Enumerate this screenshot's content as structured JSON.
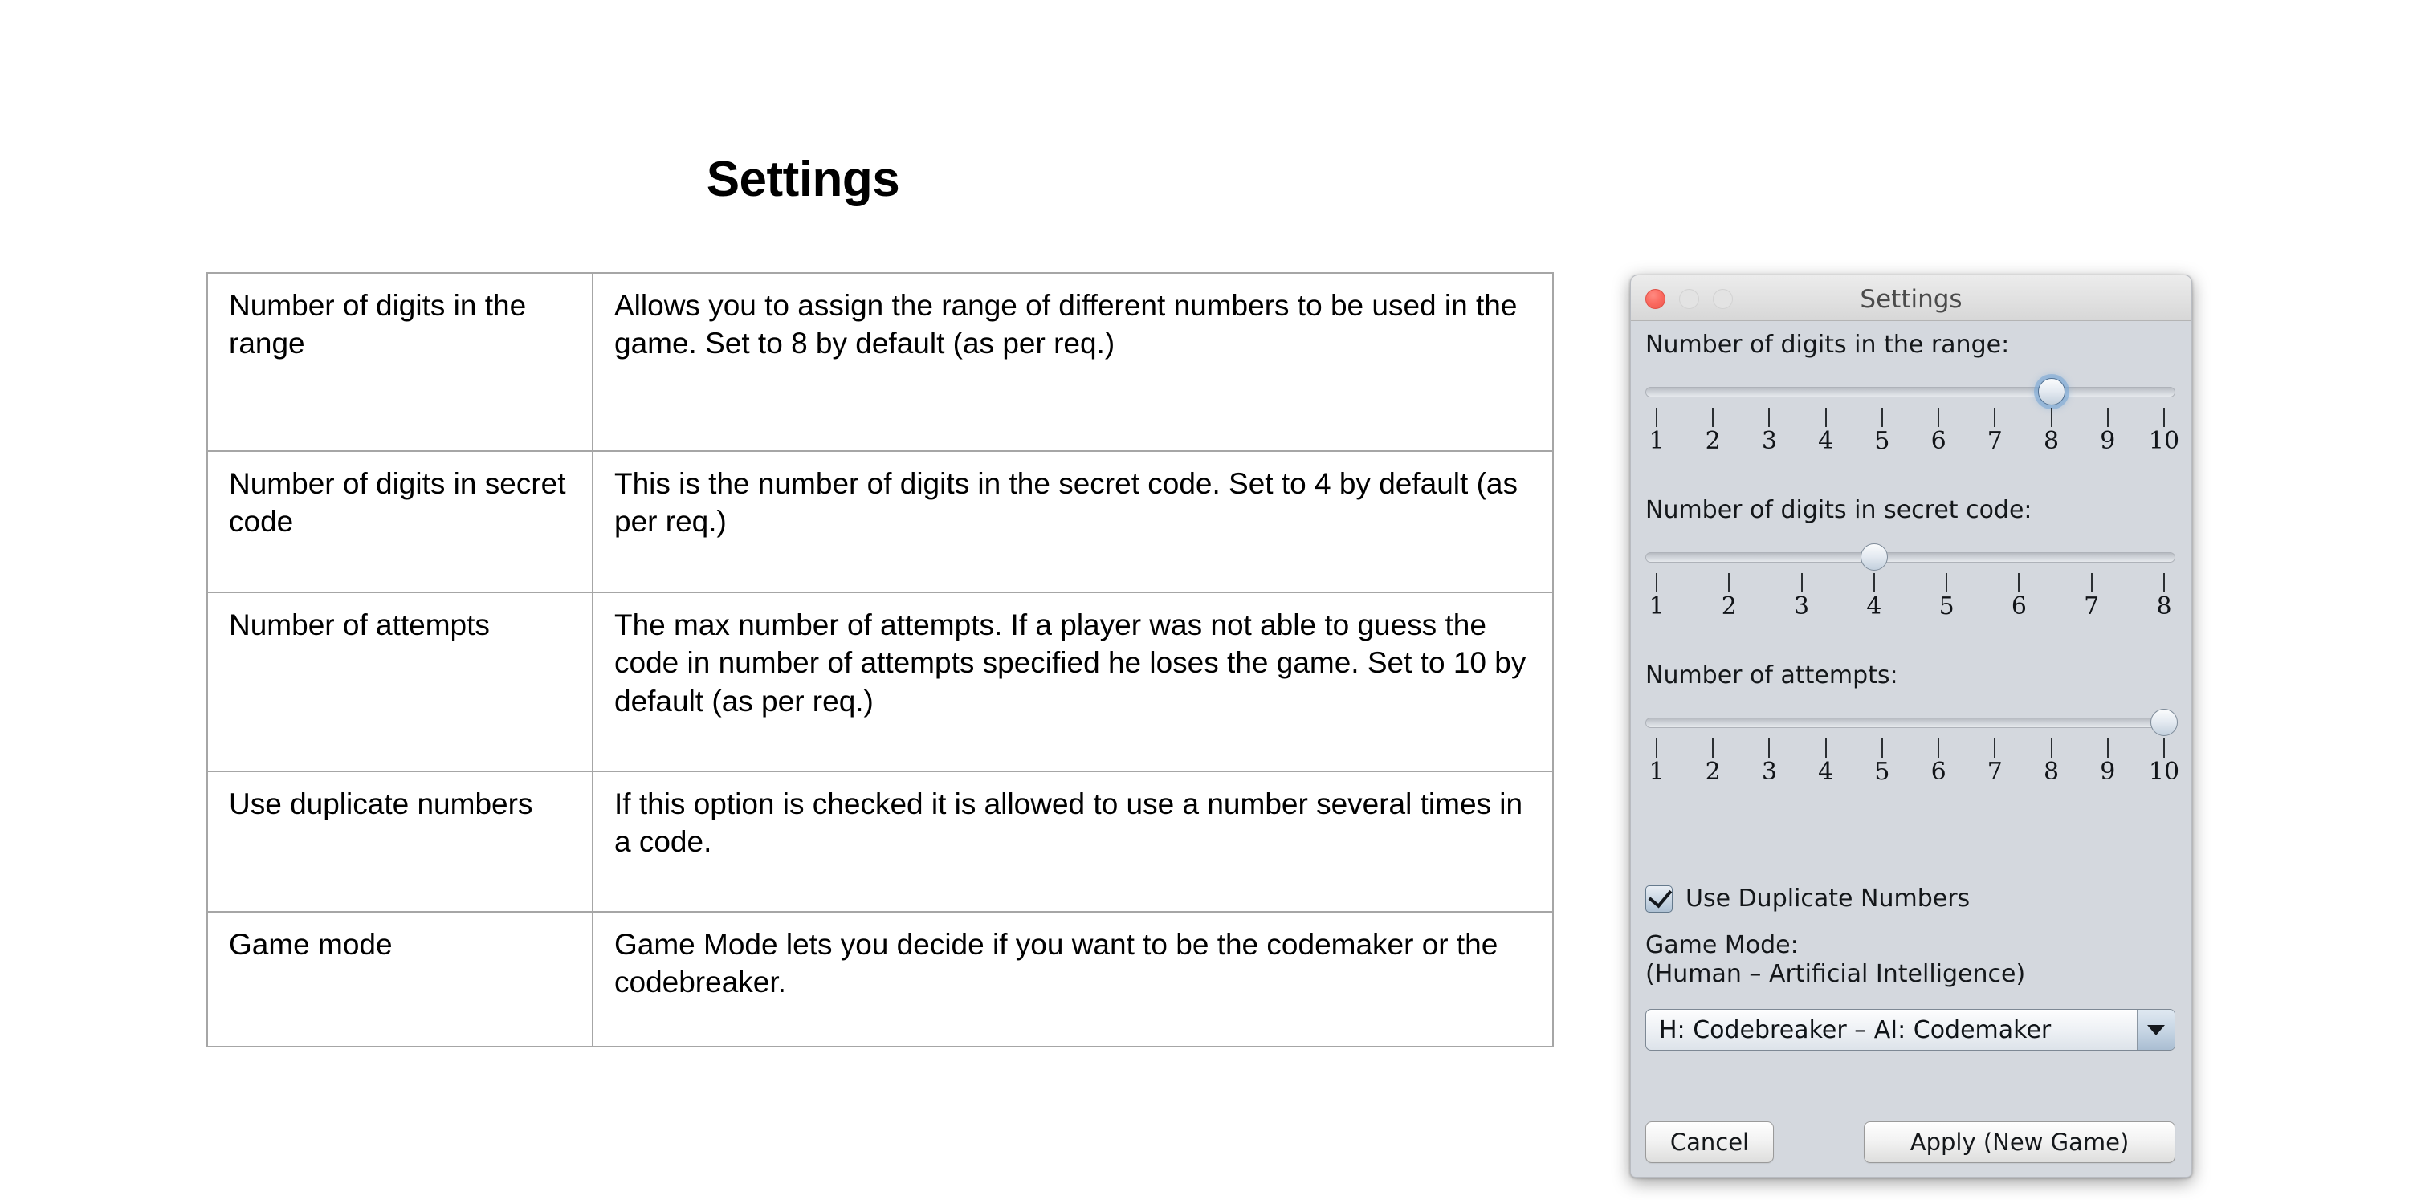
{
  "page": {
    "title": "Settings"
  },
  "doc_table": {
    "rows": [
      {
        "term": "Number of digits in the range",
        "description": "Allows you to assign the range of different numbers to be used in the game. Set to 8 by default (as per req.)"
      },
      {
        "term": "Number of digits in secret code",
        "description": "This is the number of digits in the secret code. Set to 4 by default (as per req.)"
      },
      {
        "term": "Number of attempts",
        "description": "The max number of attempts. If a player was not able to guess the code in number of attempts specified he loses the game. Set to 10 by default (as per req.)"
      },
      {
        "term": "Use duplicate numbers",
        "description": "If this option is checked it is allowed to use a number several times in a code."
      },
      {
        "term": "Game mode",
        "description": "Game Mode lets you decide if you want to be the codemaker or the codebreaker."
      }
    ]
  },
  "settings_dialog": {
    "window_title": "Settings",
    "traffic_lights": {
      "close": "close-button",
      "minimize": "minimize-button",
      "zoom": "zoom-button",
      "close_color": "#fb6c62",
      "inactive_color": "#e3e3e3"
    },
    "sliders": [
      {
        "label": "Number of digits in the range:",
        "ticks": [
          "1",
          "2",
          "3",
          "4",
          "5",
          "6",
          "7",
          "8",
          "9",
          "10"
        ],
        "min": 1,
        "max": 10,
        "value": 8,
        "focused": true
      },
      {
        "label": "Number of digits in secret code:",
        "ticks": [
          "1",
          "2",
          "3",
          "4",
          "5",
          "6",
          "7",
          "8"
        ],
        "min": 1,
        "max": 8,
        "value": 4,
        "focused": false
      },
      {
        "label": "Number of attempts:",
        "ticks": [
          "1",
          "2",
          "3",
          "4",
          "5",
          "6",
          "7",
          "8",
          "9",
          "10"
        ],
        "min": 1,
        "max": 10,
        "value": 10,
        "focused": false
      }
    ],
    "checkbox": {
      "label": "Use Duplicate Numbers",
      "checked": true
    },
    "game_mode": {
      "label_line1": "Game Mode:",
      "label_line2": "(Human – Artificial Intelligence)",
      "selected": "H: Codebreaker – AI: Codemaker"
    },
    "buttons": {
      "cancel": "Cancel",
      "apply": "Apply (New Game)"
    },
    "accent_color": "#76a5d6"
  }
}
